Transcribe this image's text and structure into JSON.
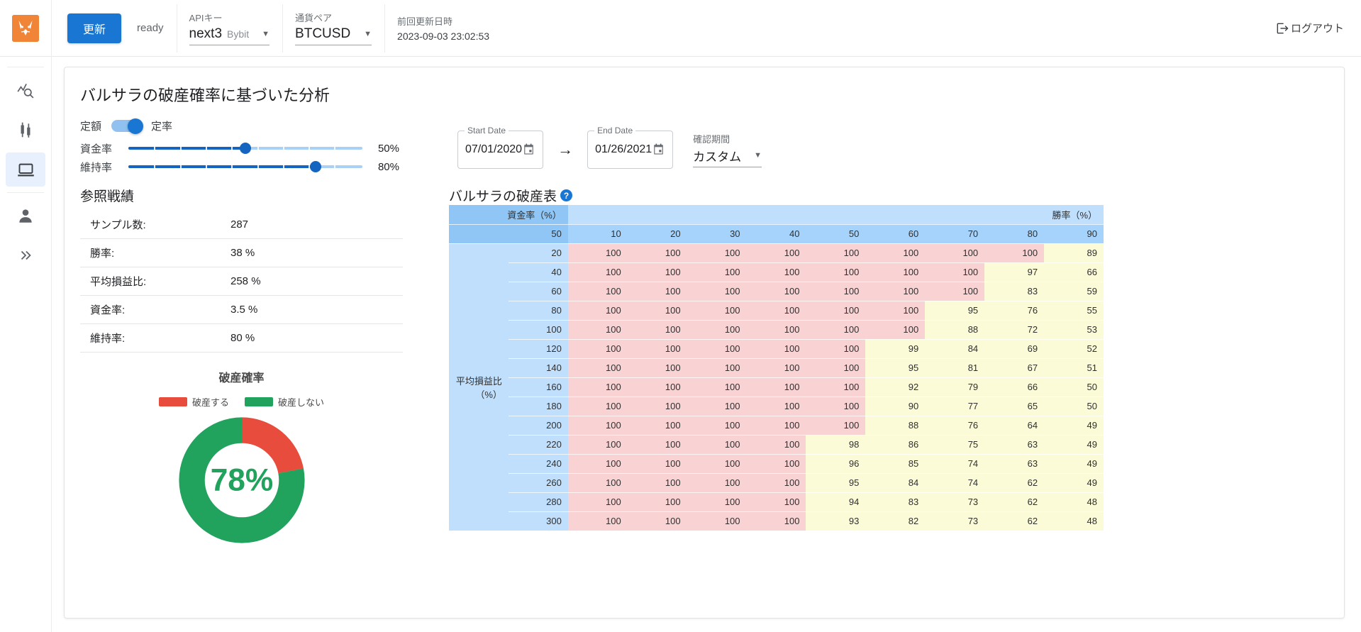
{
  "appbar": {
    "logo_icon": "shiba-logo-icon",
    "update_label": "更新",
    "status": "ready",
    "api_key": {
      "label": "APIキー",
      "value": "next3",
      "sub": "Bybit"
    },
    "pair": {
      "label": "通貨ペア",
      "value": "BTCUSD"
    },
    "last_update": {
      "label": "前回更新日時",
      "value": "2023-09-03 23:02:53"
    },
    "logout_label": "ログアウト"
  },
  "rail": {
    "items": [
      {
        "name": "chart-analysis",
        "icon": "chart-search-icon",
        "active": false
      },
      {
        "name": "candles",
        "icon": "candlestick-icon",
        "active": false
      },
      {
        "name": "simulation",
        "icon": "laptop-icon",
        "active": true
      },
      {
        "name": "account",
        "icon": "person-icon",
        "active": false
      },
      {
        "name": "expand",
        "icon": "chevron-double-right-icon",
        "active": false
      }
    ]
  },
  "card": {
    "title": "バルサラの破産確率に基づいた分析",
    "toggle": {
      "left_label": "定額",
      "right_label": "定率",
      "on": true
    },
    "sliders": [
      {
        "name": "資金率",
        "value": 50,
        "display": "50%",
        "percent": 50
      },
      {
        "name": "維持率",
        "value": 80,
        "display": "80%",
        "percent": 80
      }
    ],
    "start_date": {
      "label": "Start Date",
      "value": "07/01/2020"
    },
    "end_date": {
      "label": "End Date",
      "value": "01/26/2021"
    },
    "range_arrow": "→",
    "period_select": {
      "label": "確認期間",
      "value": "カスタム"
    }
  },
  "stats": {
    "title": "参照戦績",
    "rows": [
      {
        "key": "サンプル数:",
        "value": "287"
      },
      {
        "key": "勝率:",
        "value": "38 %"
      },
      {
        "key": "平均損益比:",
        "value": "258 %"
      },
      {
        "key": "資金率:",
        "value": "3.5 %"
      },
      {
        "key": "維持率:",
        "value": "80 %"
      }
    ]
  },
  "donut": {
    "title": "破産確率",
    "center_label": "78%",
    "legend": [
      {
        "label": "破産する",
        "color": "#e74c3c"
      },
      {
        "label": "破産しない",
        "color": "#21a35d"
      }
    ]
  },
  "chart_data": {
    "type": "pie",
    "title": "破産確率",
    "labels": [
      "破産する",
      "破産しない"
    ],
    "values": [
      22,
      78
    ],
    "colors": [
      "#e74c3c",
      "#21a35d"
    ],
    "center_text": "78%",
    "legend_position": "top"
  },
  "risk_table": {
    "title": "バルサラの破産表",
    "help_icon": "help-icon",
    "fund_group_header": "資金率（%）",
    "win_group_header": "勝率（%）",
    "fund_value": "50",
    "side_header": "平均損益比（%）",
    "columns": [
      "10",
      "20",
      "30",
      "40",
      "50",
      "60",
      "70",
      "80",
      "90"
    ],
    "rows": [
      {
        "label": "20",
        "values": [
          100,
          100,
          100,
          100,
          100,
          100,
          100,
          100,
          89
        ]
      },
      {
        "label": "40",
        "values": [
          100,
          100,
          100,
          100,
          100,
          100,
          100,
          97,
          66
        ]
      },
      {
        "label": "60",
        "values": [
          100,
          100,
          100,
          100,
          100,
          100,
          100,
          83,
          59
        ]
      },
      {
        "label": "80",
        "values": [
          100,
          100,
          100,
          100,
          100,
          100,
          95,
          76,
          55
        ]
      },
      {
        "label": "100",
        "values": [
          100,
          100,
          100,
          100,
          100,
          100,
          88,
          72,
          53
        ]
      },
      {
        "label": "120",
        "values": [
          100,
          100,
          100,
          100,
          100,
          99,
          84,
          69,
          52
        ]
      },
      {
        "label": "140",
        "values": [
          100,
          100,
          100,
          100,
          100,
          95,
          81,
          67,
          51
        ]
      },
      {
        "label": "160",
        "values": [
          100,
          100,
          100,
          100,
          100,
          92,
          79,
          66,
          50
        ]
      },
      {
        "label": "180",
        "values": [
          100,
          100,
          100,
          100,
          100,
          90,
          77,
          65,
          50
        ]
      },
      {
        "label": "200",
        "values": [
          100,
          100,
          100,
          100,
          100,
          88,
          76,
          64,
          49
        ]
      },
      {
        "label": "220",
        "values": [
          100,
          100,
          100,
          100,
          98,
          86,
          75,
          63,
          49
        ]
      },
      {
        "label": "240",
        "values": [
          100,
          100,
          100,
          100,
          96,
          85,
          74,
          63,
          49
        ]
      },
      {
        "label": "260",
        "values": [
          100,
          100,
          100,
          100,
          95,
          84,
          74,
          62,
          49
        ]
      },
      {
        "label": "280",
        "values": [
          100,
          100,
          100,
          100,
          94,
          83,
          73,
          62,
          48
        ]
      },
      {
        "label": "300",
        "values": [
          100,
          100,
          100,
          100,
          93,
          82,
          73,
          62,
          48
        ]
      }
    ],
    "red_threshold": 100,
    "colors": {
      "red": "#f9d2d4",
      "yellow": "#fbfbd8",
      "header": "#8fc6f5",
      "subheader": "#bfdffc"
    }
  }
}
